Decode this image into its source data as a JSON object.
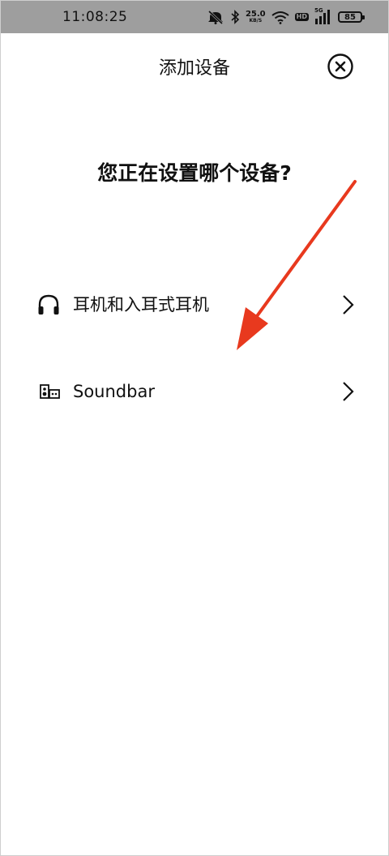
{
  "status_bar": {
    "time": "11:08:25",
    "net_speed_value": "25.0",
    "net_speed_unit": "KB/S",
    "hd_label": "HD",
    "signal_label": "5G",
    "battery_level": "85",
    "icons": [
      "mute-icon",
      "bluetooth-icon",
      "wifi-icon",
      "hd-icon",
      "signal-icon",
      "battery-icon"
    ]
  },
  "header": {
    "title": "添加设备",
    "close_icon": "close-icon"
  },
  "main": {
    "question": "您正在设置哪个设备?",
    "devices": [
      {
        "label": "耳机和入耳式耳机",
        "icon": "headphones-icon"
      },
      {
        "label": "Soundbar",
        "icon": "soundbar-icon"
      }
    ]
  },
  "colors": {
    "status_bar_bg": "#9e9e9e",
    "text": "#111111",
    "annotation_arrow": "#e8391e"
  }
}
